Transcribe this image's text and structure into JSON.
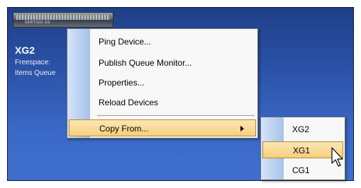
{
  "device": {
    "brand": "VERTIGO XG",
    "name": "XG2",
    "freespace_label": "Freespace:",
    "items_label": "Items Queue"
  },
  "context_menu": {
    "items": [
      {
        "label": "Ping Device..."
      },
      {
        "label": "Publish Queue Monitor..."
      },
      {
        "label": "Properties..."
      },
      {
        "label": "Reload Devices"
      }
    ],
    "copy_from": {
      "label": "Copy From...",
      "highlighted": true
    }
  },
  "submenu": {
    "items": [
      {
        "label": "XG2",
        "highlighted": false
      },
      {
        "label": "XG1",
        "highlighted": true
      },
      {
        "label": "CG1",
        "highlighted": false
      }
    ]
  },
  "colors": {
    "background_top": "#1f3f86",
    "background_bottom": "#3f6fcd",
    "highlight": "#f6cf7d",
    "menu_gutter": "#b9cff0"
  },
  "icons": {
    "cursor": "arrow-pointer-icon",
    "submenu_arrow": "chevron-right-icon"
  }
}
